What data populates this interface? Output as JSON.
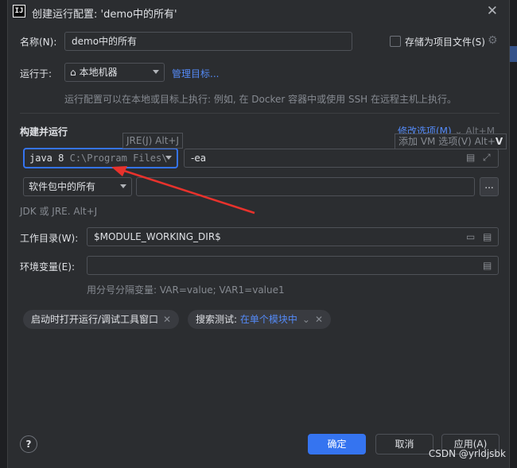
{
  "window": {
    "title": "创建运行配置: 'demo中的所有'",
    "app_icon": "IJ"
  },
  "name_field": {
    "label": "名称(N):",
    "value": "demo中的所有"
  },
  "store_as_project": {
    "label": "存储为项目文件(S)",
    "checked": false
  },
  "run_on": {
    "label": "运行于:",
    "target": "本地机器",
    "manage_link": "管理目标...",
    "hint": "运行配置可以在本地或目标上执行: 例如, 在 Docker 容器中或使用 SSH 在远程主机上执行。"
  },
  "build_run": {
    "title": "构建并运行",
    "modify_options": "修改选项(M)",
    "modify_shortcut": "Alt+M",
    "jre_tooltip": "JRE(J) Alt+J",
    "vm_tooltip_text": "添加 VM 选项(V) Alt+",
    "vm_tooltip_key": "V",
    "jre_version": "java 8",
    "jre_path": "C:\\Program Files\\",
    "vm_options": "-ea",
    "package_scope": "软件包中的所有",
    "package_value": "",
    "browse_label": "...",
    "jdk_hint": "JDK 或 JRE. Alt+J"
  },
  "working_dir": {
    "label": "工作目录(W):",
    "value": "$MODULE_WORKING_DIR$"
  },
  "env_vars": {
    "label": "环境变量(E):",
    "value": "",
    "hint": "用分号分隔变量: VAR=value; VAR1=value1"
  },
  "chips": {
    "open_tool_window": "启动时打开运行/调试工具窗口",
    "search_prefix": "搜索测试:",
    "search_value": "在单个模块中"
  },
  "buttons": {
    "help": "?",
    "ok": "确定",
    "cancel": "取消",
    "apply": "应用(A)"
  },
  "watermark": "CSDN @yrldjsbk",
  "annotation_color": "#e8322c"
}
